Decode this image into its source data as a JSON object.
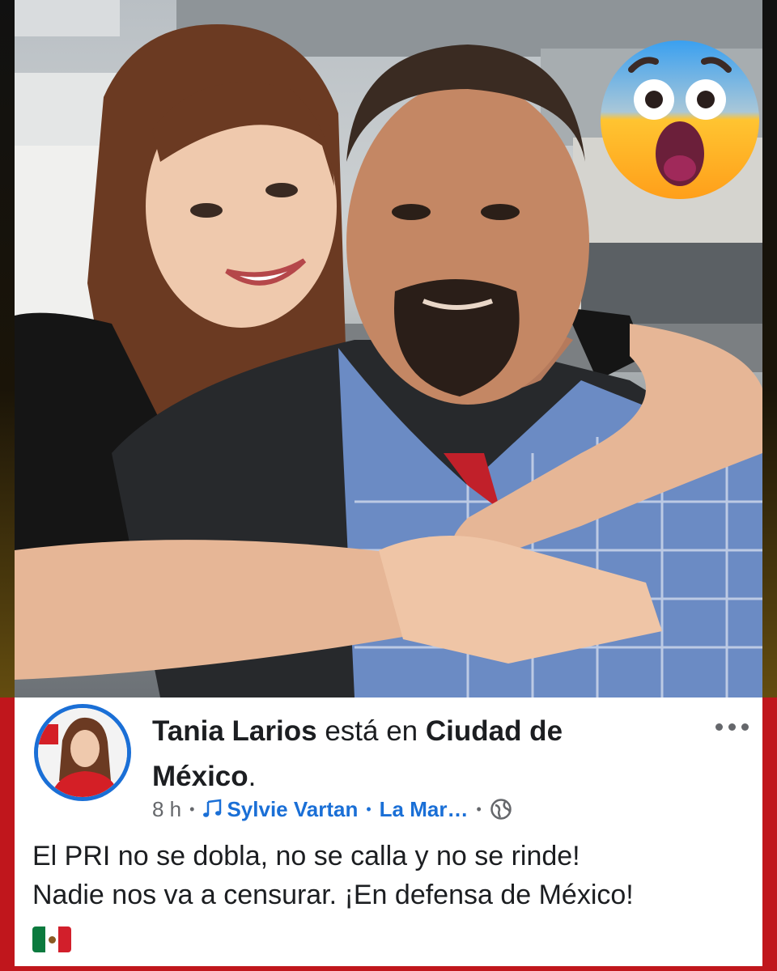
{
  "post": {
    "author": "Tania Larios",
    "location_prefix": "está en",
    "location": "Ciudad de",
    "location_line2": "México",
    "location_end": ".",
    "time": "8 h",
    "music_artist": "Sylvie Vartan",
    "song_title": "La Mar…",
    "body_line1": "El PRI no se dobla, no se calla y no se rinde!",
    "body_line2": "Nadie nos va a censurar. ¡En defensa de México!"
  },
  "icons": {
    "more": "more-options-icon",
    "music": "music-note-icon",
    "privacy": "globe-icon",
    "flag": "mexico-flag-icon",
    "reaction": "fearful-face-emoji"
  },
  "colors": {
    "frame": "#c0161c",
    "link": "#1a6fd6",
    "text": "#1c1e21",
    "muted": "#65676b"
  }
}
